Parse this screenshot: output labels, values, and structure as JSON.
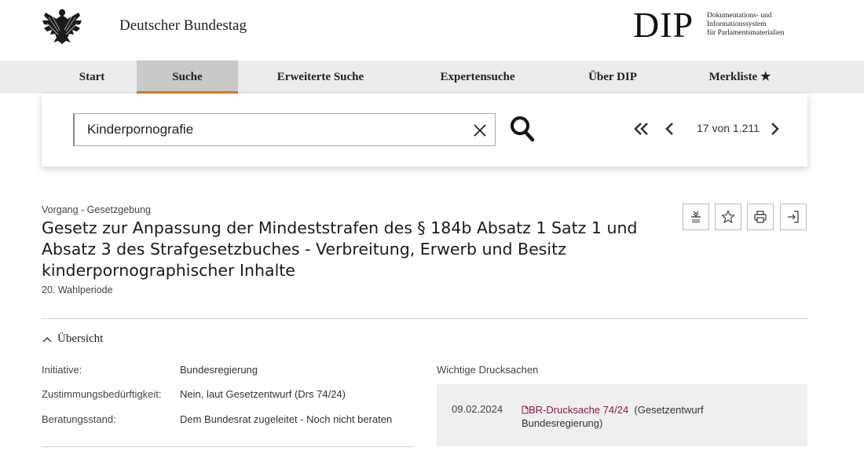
{
  "header": {
    "org_name": "Deutscher Bundestag",
    "logo_text": "DIP",
    "logo_sub": [
      "Dokumentations- und",
      "Informationssystem",
      "für Parlamentsmaterialien"
    ]
  },
  "nav": {
    "items": [
      {
        "label": "Start"
      },
      {
        "label": "Suche",
        "active": true
      },
      {
        "label": "Erweiterte Suche"
      },
      {
        "label": "Expertensuche"
      },
      {
        "label": "Über DIP"
      },
      {
        "label": "Merkliste ★"
      }
    ]
  },
  "search": {
    "value": "Kinderpornografie",
    "pager_text": "17 von 1.211"
  },
  "document": {
    "type": "Vorgang - Gesetzgebung",
    "title": "Gesetz zur Anpassung der Mindeststrafen des § 184b Absatz 1 Satz 1 und Absatz 3 des Strafgesetzbuches - Verbreitung, Erwerb und Besitz kinderpornographischer Inhalte",
    "period": "20. Wahlperiode",
    "tools": [
      "collapse-all-icon",
      "star-icon",
      "print-icon",
      "export-icon"
    ]
  },
  "overview": {
    "toggle_label": "Übersicht",
    "rows": [
      {
        "label": "Initiative:",
        "value": "Bundesregierung"
      },
      {
        "label": "Zustimmungsbedürftigkeit:",
        "value": "Nein, laut Gesetzentwurf (Drs 74/24)"
      },
      {
        "label": "Beratungsstand:",
        "value": "Dem Bundesrat zugeleitet - Noch nicht beraten"
      }
    ]
  },
  "important_docs": {
    "heading": "Wichtige Drucksachen",
    "entries": [
      {
        "date": "09.02.2024",
        "link": "BR-Drucksache 74/24",
        "suffix": "(Gesetzentwurf Bundesregierung)"
      }
    ]
  },
  "colors": {
    "accent_orange": "#d97a1e",
    "link_red": "#8a1c3c",
    "nav_bg": "#ececec",
    "nav_active_bg": "#c9c9c9"
  }
}
